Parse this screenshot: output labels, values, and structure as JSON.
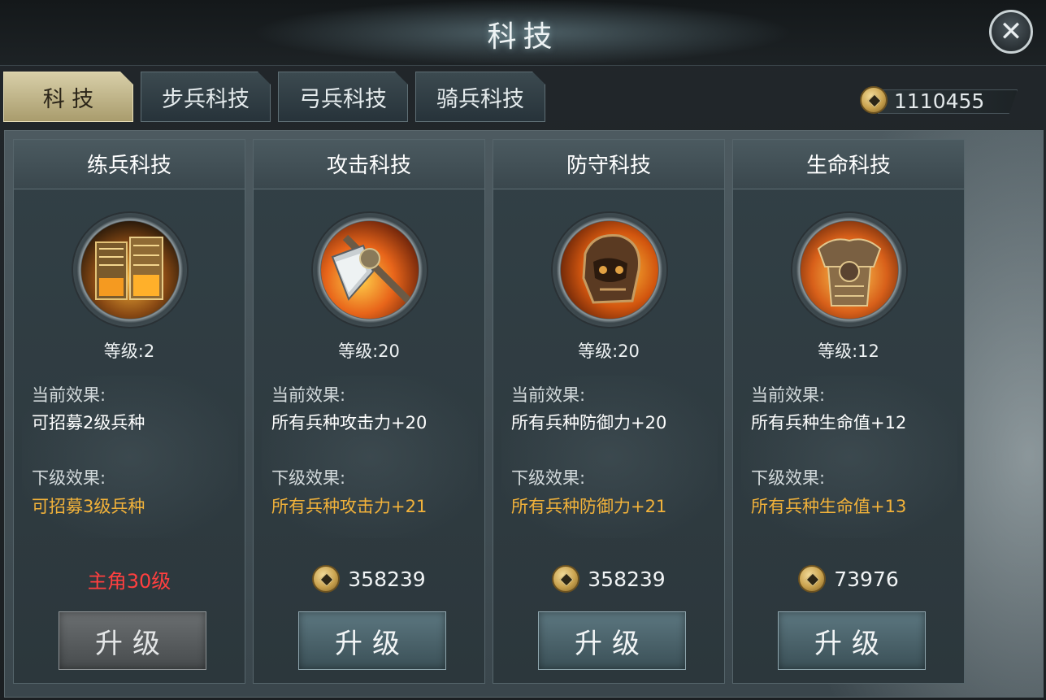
{
  "window": {
    "title": "科技"
  },
  "tabs": [
    {
      "label": "科 技",
      "active": true
    },
    {
      "label": "步兵科技",
      "active": false
    },
    {
      "label": "弓兵科技",
      "active": false
    },
    {
      "label": "骑兵科技",
      "active": false
    }
  ],
  "currency": {
    "icon": "coin-icon",
    "amount": "1110455"
  },
  "cards": [
    {
      "title": "练兵科技",
      "icon": "training-icon",
      "level": "等级:2",
      "current_label": "当前效果:",
      "current_effect": "可招募2级兵种",
      "next_label": "下级效果:",
      "next_effect": "可招募3级兵种",
      "requirement": "主角30级",
      "upgrade_label": "升级"
    },
    {
      "title": "攻击科技",
      "icon": "axe-icon",
      "level": "等级:20",
      "current_label": "当前效果:",
      "current_effect": "所有兵种攻击力+20",
      "next_label": "下级效果:",
      "next_effect": "所有兵种攻击力+21",
      "cost": "358239",
      "upgrade_label": "升级"
    },
    {
      "title": "防守科技",
      "icon": "helmet-icon",
      "level": "等级:20",
      "current_label": "当前效果:",
      "current_effect": "所有兵种防御力+20",
      "next_label": "下级效果:",
      "next_effect": "所有兵种防御力+21",
      "cost": "358239",
      "upgrade_label": "升级"
    },
    {
      "title": "生命科技",
      "icon": "armor-icon",
      "level": "等级:12",
      "current_label": "当前效果:",
      "current_effect": "所有兵种生命值+12",
      "next_label": "下级效果:",
      "next_effect": "所有兵种生命值+13",
      "cost": "73976",
      "upgrade_label": "升级"
    }
  ],
  "colors": {
    "next_effect": "#f2b23a",
    "requirement": "#ff3f3f",
    "active_tab": "#d8cfa8"
  }
}
